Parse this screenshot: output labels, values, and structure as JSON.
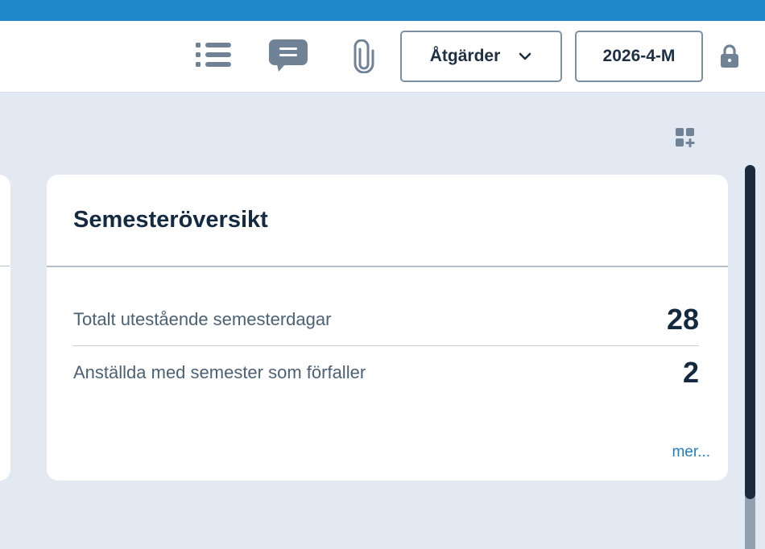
{
  "toolbar": {
    "icons": {
      "list": "list-icon",
      "comment": "comment-icon",
      "attachment": "paperclip-icon",
      "lock": "lock-icon"
    },
    "actions_label": "Åtgärder",
    "period_label": "2026-4-M"
  },
  "dashboard": {
    "add_widget_icon": "add-widget-icon"
  },
  "card": {
    "title": "Semesteröversikt",
    "rows": [
      {
        "label": "Totalt utestående semesterdagar",
        "value": "28"
      },
      {
        "label": "Anställda med semester som förfaller",
        "value": "2"
      }
    ],
    "more_link": "mer..."
  },
  "colors": {
    "top_strip": "#1e88c9",
    "background": "#e2e9f2",
    "icon": "#6f8296",
    "link": "#1e7fc2",
    "text_dark": "#142a40"
  }
}
